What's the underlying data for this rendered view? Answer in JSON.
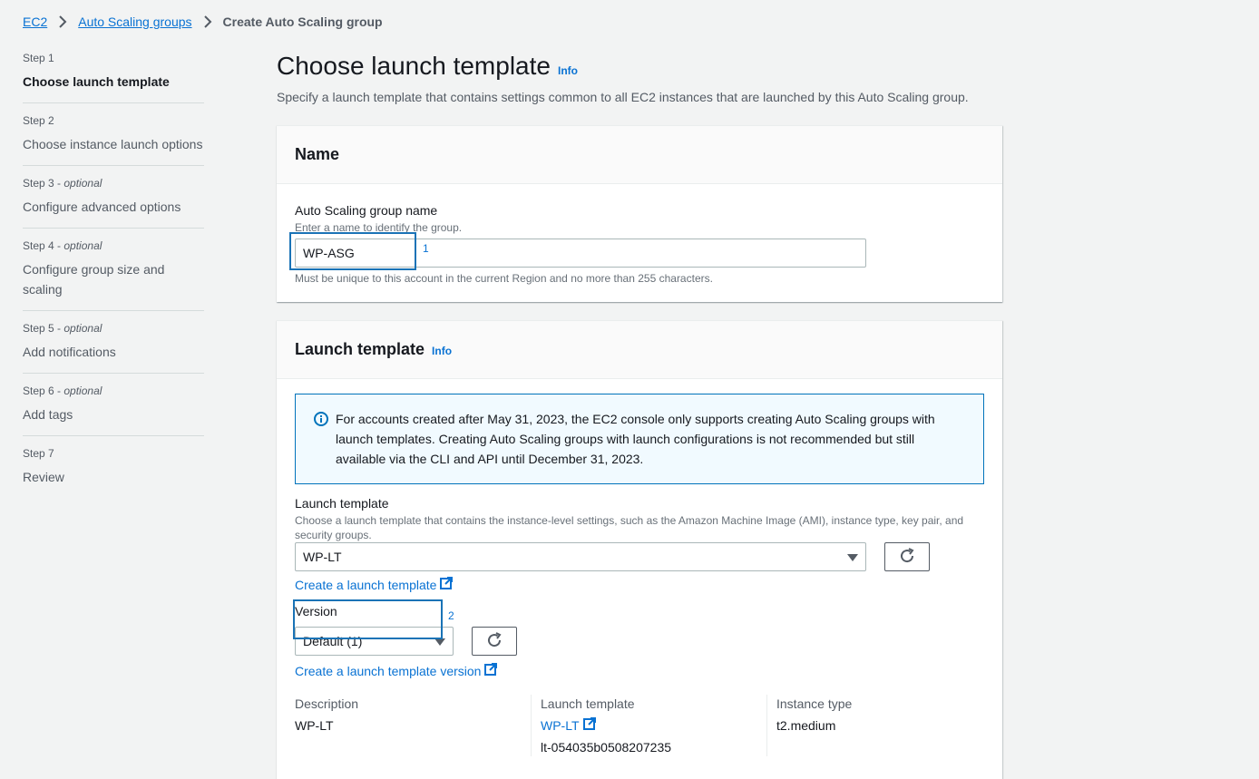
{
  "breadcrumb": {
    "items": [
      "EC2",
      "Auto Scaling groups"
    ],
    "current": "Create Auto Scaling group"
  },
  "steps": [
    {
      "num": "Step 1",
      "optional": "",
      "title": "Choose launch template"
    },
    {
      "num": "Step 2",
      "optional": "",
      "title": "Choose instance launch options"
    },
    {
      "num": "Step 3",
      "optional": "optional",
      "title": "Configure advanced options"
    },
    {
      "num": "Step 4",
      "optional": "optional",
      "title": "Configure group size and scaling"
    },
    {
      "num": "Step 5",
      "optional": "optional",
      "title": "Add notifications"
    },
    {
      "num": "Step 6",
      "optional": "optional",
      "title": "Add tags"
    },
    {
      "num": "Step 7",
      "optional": "",
      "title": "Review"
    }
  ],
  "page": {
    "title": "Choose launch template",
    "info": "Info",
    "description": "Specify a launch template that contains settings common to all EC2 instances that are launched by this Auto Scaling group."
  },
  "name_card": {
    "header": "Name",
    "label": "Auto Scaling group name",
    "hint": "Enter a name to identify the group.",
    "value": "WP-ASG",
    "constraint": "Must be unique to this account in the current Region and no more than 255 characters.",
    "marker": "1"
  },
  "lt_card": {
    "header": "Launch template",
    "info": "Info",
    "alert": "For accounts created after May 31, 2023, the EC2 console only supports creating Auto Scaling groups with launch templates. Creating Auto Scaling groups with launch configurations is not recommended but still available via the CLI and API until December 31, 2023.",
    "lt_label": "Launch template",
    "lt_hint": "Choose a launch template that contains the instance-level settings, such as the Amazon Machine Image (AMI), instance type, key pair, and security groups.",
    "lt_value": "WP-LT",
    "marker": "2",
    "create_lt_link": "Create a launch template",
    "version_label": "Version",
    "version_value": "Default (1)",
    "create_version_link": "Create a launch template version",
    "details": {
      "description_key": "Description",
      "description_val": "WP-LT",
      "lt_key": "Launch template",
      "lt_link": "WP-LT",
      "lt_id": "lt-054035b0508207235",
      "instance_type_key": "Instance type",
      "instance_type_val": "t2.medium"
    }
  },
  "colors": {
    "link": "#0972d3",
    "highlight": "#1a73b6",
    "alert_border": "#0073bb",
    "alert_bg": "#f1faff"
  }
}
